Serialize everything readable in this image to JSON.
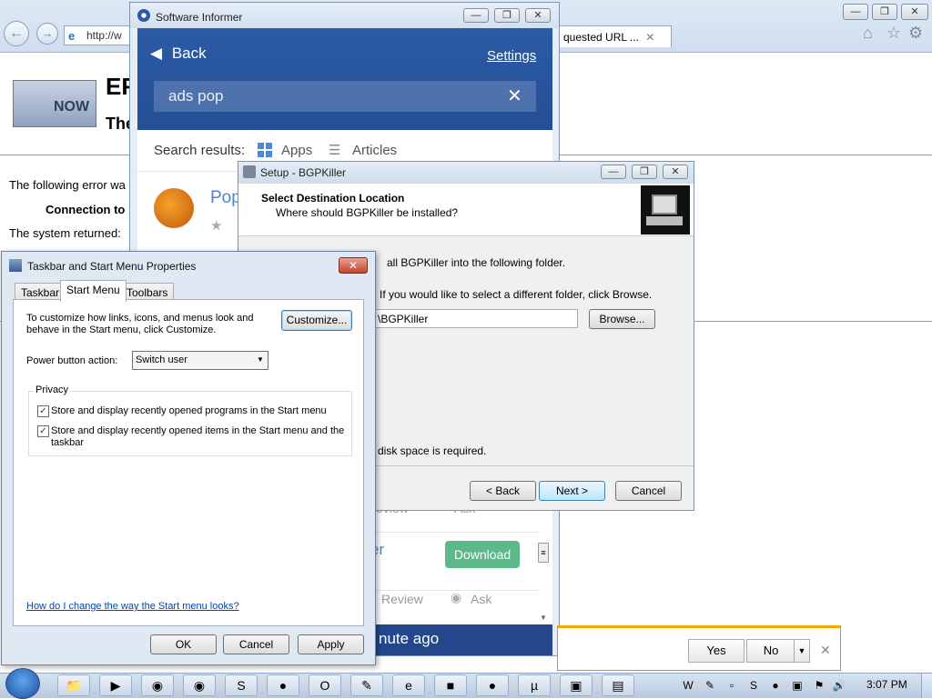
{
  "browser": {
    "address_text": "http://w",
    "tab_label": "quested URL ...",
    "tab_close": "✕",
    "logo_text": "NOW",
    "page_heading": "ER",
    "page_subheading": "The",
    "error_line1": "The following error wa",
    "error_line2": "Connection to",
    "error_line3": "The system returned:"
  },
  "software_informer": {
    "window_title": "Software Informer",
    "back_label": "Back",
    "settings_label": "Settings",
    "search_value": "ads pop",
    "search_results_label": "Search results:",
    "tab_apps": "Apps",
    "tab_articles": "Articles",
    "result_title": "Pop",
    "review_label": "Review",
    "ask_label": "Ask",
    "partial_title": "er",
    "download_label": "Download",
    "timestamp": "nute ago"
  },
  "setup": {
    "window_title": "Setup - BGPKiller",
    "header_title": "Select Destination Location",
    "header_subtitle": "Where should BGPKiller be installed?",
    "install_text": "all BGPKiller into the following folder.",
    "browse_text": "If you would like to select a different folder, click Browse.",
    "path_value": "\\BGPKiller",
    "browse_button": "Browse...",
    "disk_text": "disk space is required.",
    "back_button": "< Back",
    "next_button": "Next >",
    "cancel_button": "Cancel"
  },
  "taskbar_dialog": {
    "title": "Taskbar and Start Menu Properties",
    "tabs": [
      "Taskbar",
      "Start Menu",
      "Toolbars"
    ],
    "customize_text": "To customize how links, icons, and menus look and behave in the Start menu, click Customize.",
    "customize_button": "Customize...",
    "power_label": "Power button action:",
    "power_value": "Switch user",
    "privacy_label": "Privacy",
    "privacy_programs": "Store and display recently opened programs in the Start menu",
    "privacy_items": "Store and display recently opened items in the Start menu and the taskbar",
    "help_link": "How do I change the way the Start menu looks?",
    "ok_button": "OK",
    "cancel_button": "Cancel",
    "apply_button": "Apply"
  },
  "notification": {
    "yes_button": "Yes",
    "no_button": "No"
  },
  "system_taskbar": {
    "clock": "3:07 PM"
  },
  "colors": {
    "si_blue": "#2b5aa6",
    "download_green": "#5cb98a",
    "notification_accent": "#f2a900",
    "link_blue": "#0645ad"
  }
}
